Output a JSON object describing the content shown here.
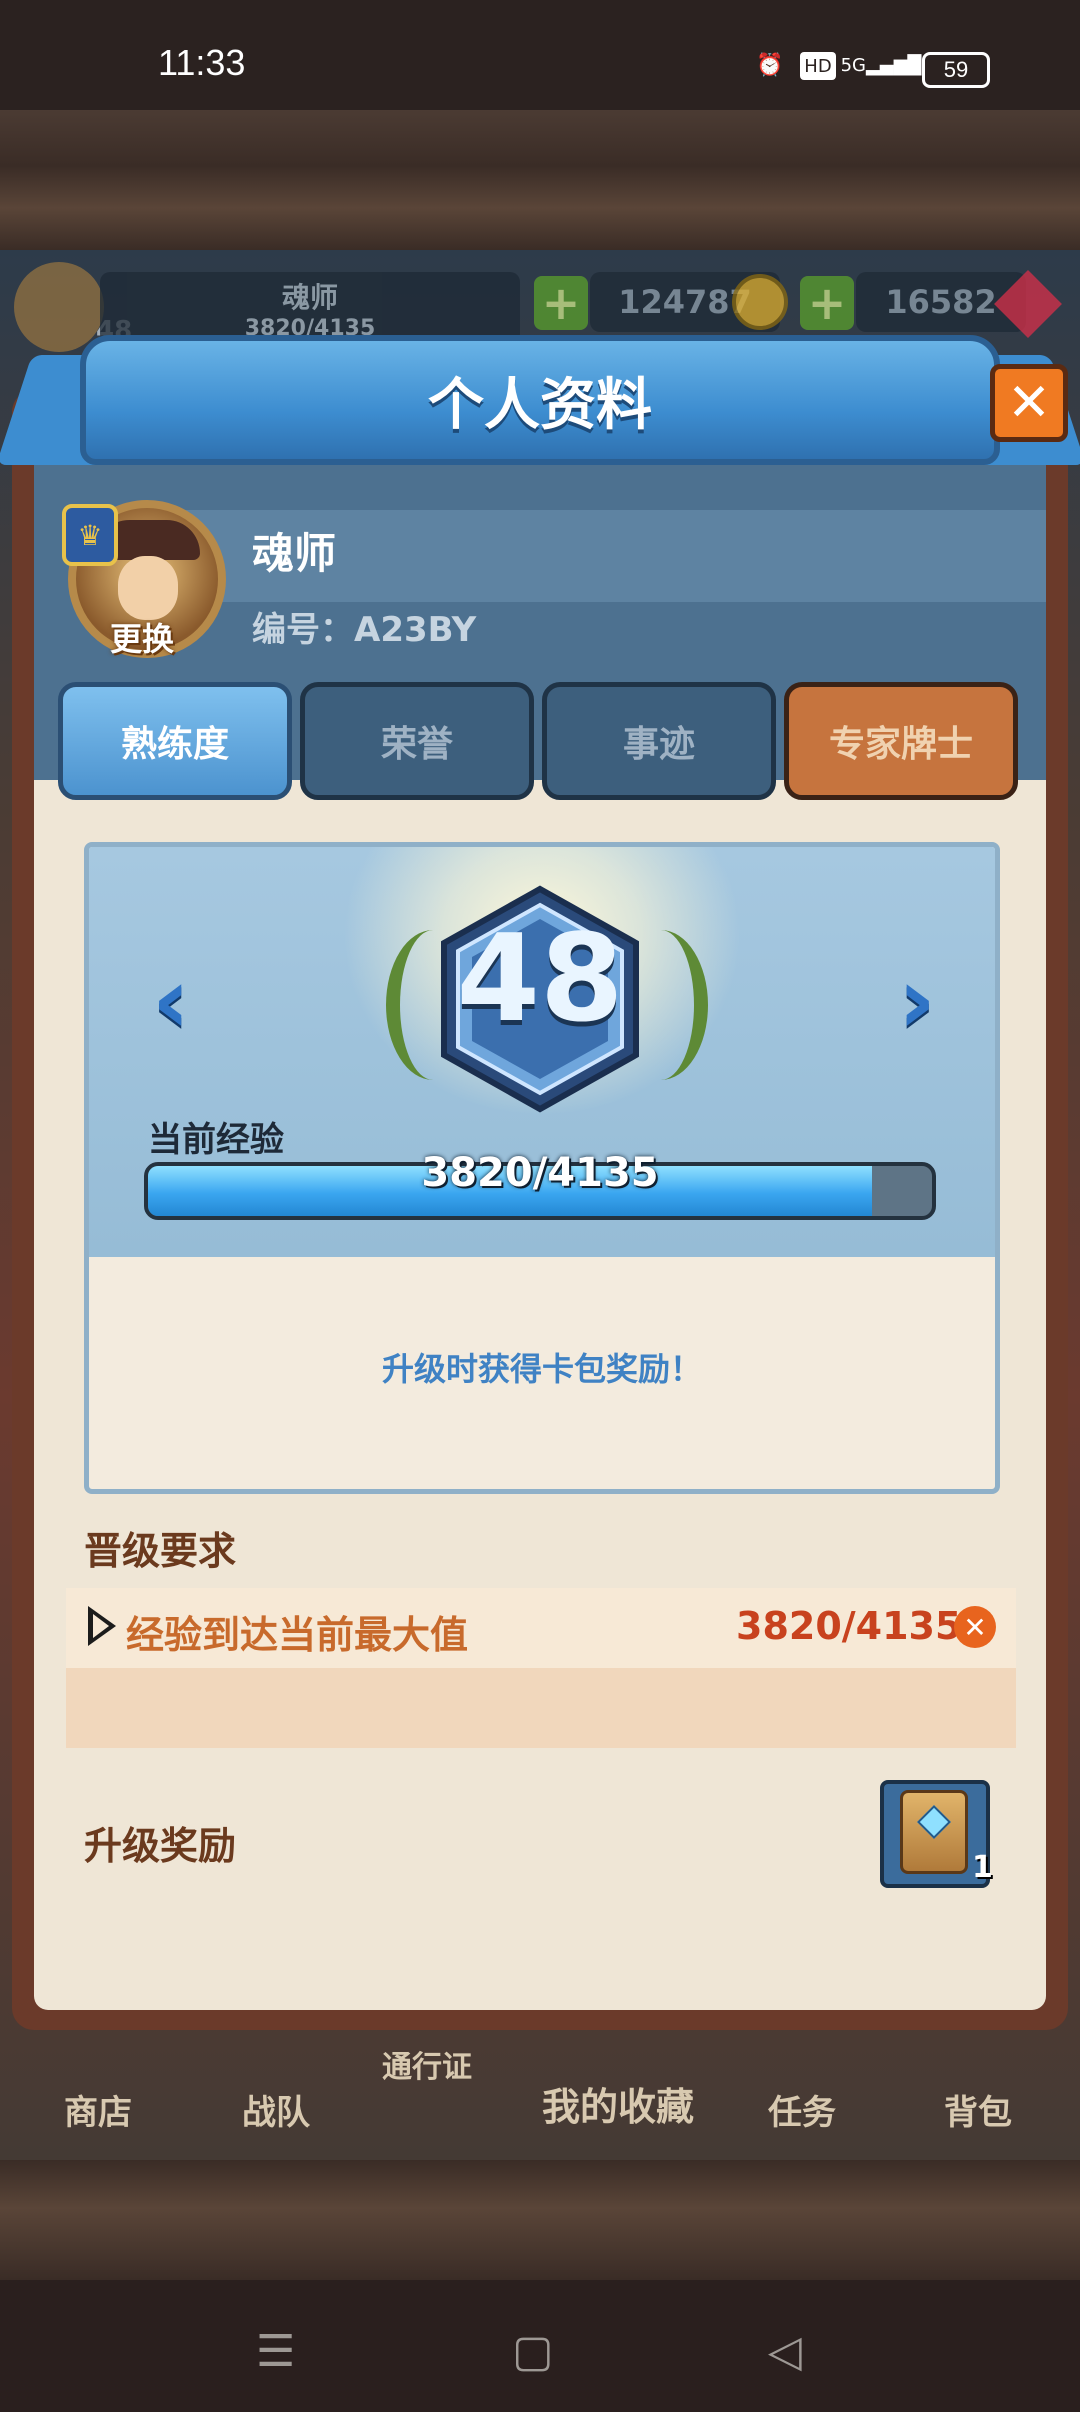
{
  "status_bar": {
    "time": "11:33",
    "network": "5G",
    "hd": "HD",
    "battery": "59"
  },
  "top_bar": {
    "player_name": "魂师",
    "player_level_badge": "48",
    "player_exp_small": "3820/4135",
    "gold": "124787",
    "gems": "16582"
  },
  "bottom_nav": {
    "items": [
      "商店",
      "战队",
      "通行证",
      "我的收藏",
      "任务",
      "背包"
    ]
  },
  "dialog": {
    "title": "个人资料",
    "close_label": "✕",
    "profile": {
      "name": "魂师",
      "id_line": "编号：A23BY",
      "change_label": "更换"
    },
    "tabs": [
      {
        "label": "熟练度",
        "state": "active"
      },
      {
        "label": "荣誉",
        "state": "normal"
      },
      {
        "label": "事迹",
        "state": "normal"
      },
      {
        "label": "专家牌士",
        "state": "expert"
      }
    ],
    "level": {
      "value": "48",
      "exp_label": "当前经验",
      "exp_text": "3820/4135",
      "exp_current": 3820,
      "exp_max": 4135,
      "reward_tip": "升级时获得卡包奖励！"
    },
    "requirements": {
      "title": "晋级要求",
      "item_text": "经验到达当前最大值",
      "item_value": "3820/4135"
    },
    "rewards": {
      "title": "升级奖励",
      "item_count": "1"
    }
  },
  "colors": {
    "accent_blue": "#3d8dd0",
    "close_orange": "#f07a22",
    "requirement_text": "#c86a2c"
  }
}
